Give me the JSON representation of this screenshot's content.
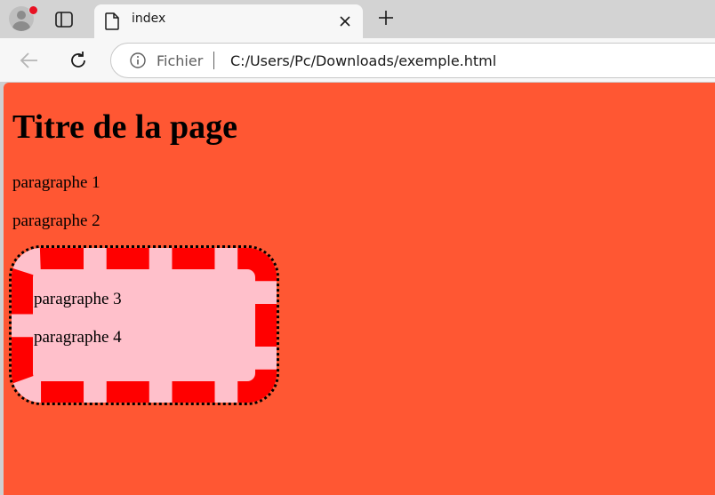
{
  "browser": {
    "tab": {
      "title": "index"
    },
    "address_bar": {
      "site_label": "Fichier",
      "url": "C:/Users/Pc/Downloads/exemple.html"
    },
    "icons": {
      "profile": "profile-avatar-icon",
      "tab_actions": "tab-actions-icon",
      "page": "page-icon",
      "close": "close-icon",
      "new_tab": "plus-icon",
      "back": "back-arrow-icon",
      "reload": "reload-icon",
      "info": "info-icon"
    }
  },
  "page": {
    "title": "Titre de la page",
    "paragraphs": [
      "paragraphe 1",
      "paragraphe 2"
    ],
    "box": {
      "paragraphs": [
        "paragraphe 3",
        "paragraphe 4"
      ]
    }
  },
  "colors": {
    "page_background": "#ff5733",
    "box_background": "#ffc0cb",
    "box_border": "#ff0000",
    "box_outline": "#000000"
  }
}
